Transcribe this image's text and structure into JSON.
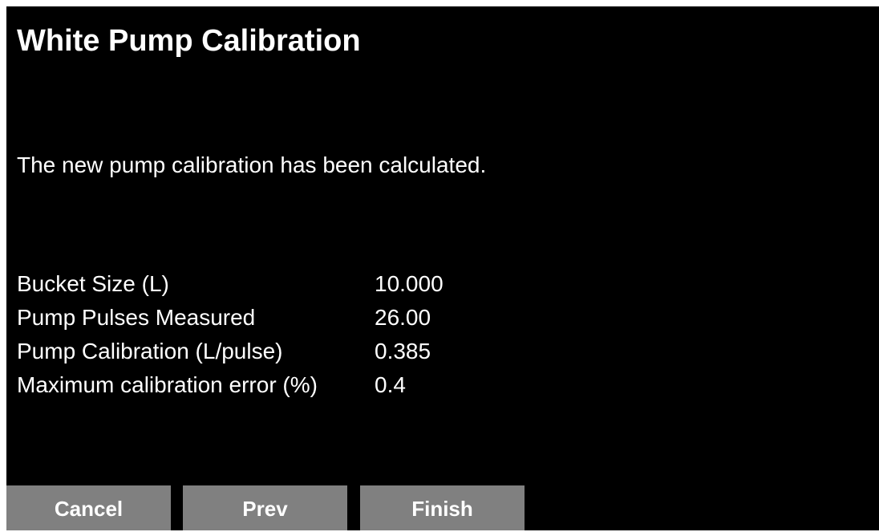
{
  "header": {
    "title": "White Pump Calibration"
  },
  "message": "The new pump calibration has been calculated.",
  "results": [
    {
      "label": "Bucket Size (L)",
      "value": "10.000"
    },
    {
      "label": "Pump Pulses Measured",
      "value": "26.00"
    },
    {
      "label": "Pump Calibration (L/pulse)",
      "value": "0.385"
    },
    {
      "label": "Maximum calibration error (%)",
      "value": "0.4"
    }
  ],
  "buttons": {
    "cancel": "Cancel",
    "prev": "Prev",
    "finish": "Finish"
  },
  "colors": {
    "background": "#000000",
    "text": "#ffffff",
    "button": "#808080"
  }
}
